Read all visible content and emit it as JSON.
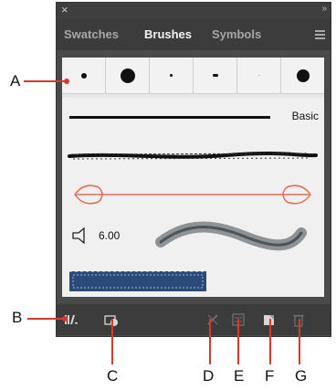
{
  "panel": {
    "close_glyph": "×",
    "collapse_glyph": "»",
    "tabs": [
      {
        "label": "Swatches",
        "active": false
      },
      {
        "label": "Brushes",
        "active": true
      },
      {
        "label": "Symbols",
        "active": false
      }
    ]
  },
  "brushes": {
    "basic_label": "Basic",
    "bristle_size": "6.00"
  },
  "callouts": [
    "A",
    "B",
    "C",
    "D",
    "E",
    "F",
    "G"
  ],
  "colors": {
    "panel_bg": "#4a4a4a",
    "tab_bar_bg": "#3c3c3c",
    "active_tab_text": "#f2f2f2",
    "inactive_tab_text": "#a7a7a7",
    "leader_line": "#d9382b",
    "arrow_brush": "#e86a52"
  },
  "icons": {
    "close": "close-icon",
    "panel_menu": "panel-menu-icon",
    "bristle": "bristle-brush-icon",
    "brush_libraries": "brush-libraries-menu-icon",
    "libraries_panel": "libraries-panel-icon",
    "remove_stroke": "remove-brush-stroke-icon",
    "options": "options-of-selected-object-icon",
    "new_brush": "new-brush-icon",
    "delete_brush": "delete-brush-icon"
  }
}
